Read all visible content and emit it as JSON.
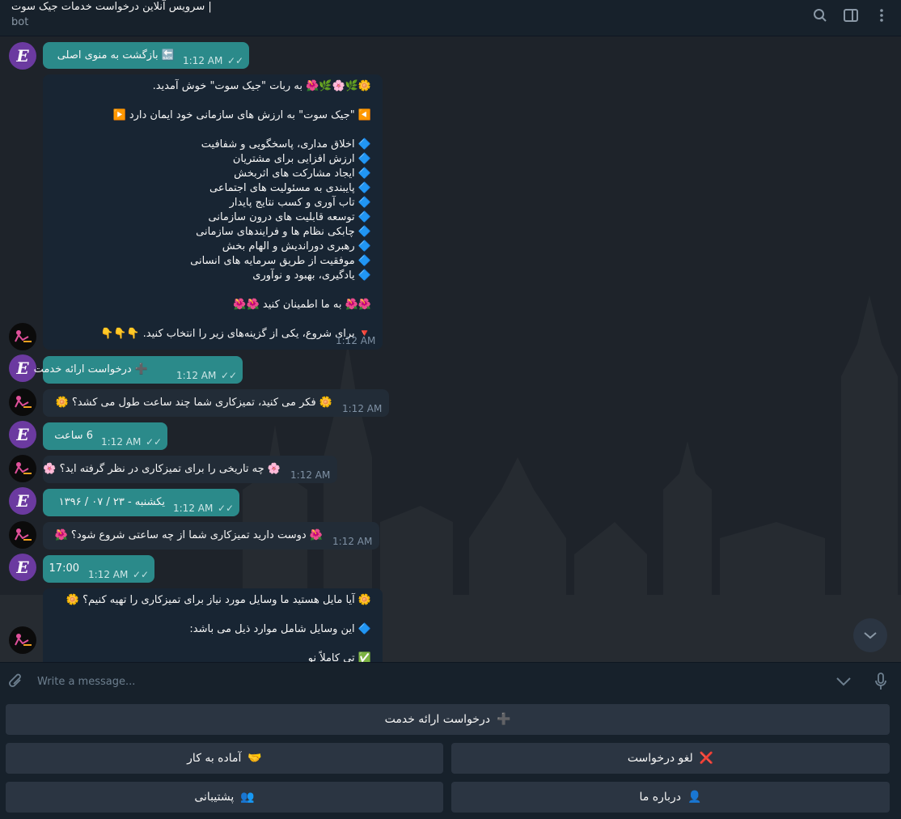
{
  "header": {
    "title": "سرویس آنلاین درخواست خدمات جیک سوت |",
    "subtitle": "bot"
  },
  "user_avatar_letter": "E",
  "messages": [
    {
      "type": "out",
      "emoji": "🔙",
      "text": "بازگشت به منوی اصلی",
      "time": "1:12 AM",
      "ticks": "✓✓"
    },
    {
      "type": "in_big",
      "lines": [
        "🌼🌿🌸🌿🌺 به ربات \"جیک سوت\" خوش آمدید.",
        "",
        "◀️ \"جیک سوت\" به ارزش های  سازمانی خود ایمان دارد ▶️",
        "",
        "🔷 اخلاق مداری، پاسخگویی و شفافیت",
        "🔷 ارزش افزایی برای مشتریان",
        "🔷 ایجاد مشارکت های اثربخش",
        "🔷 پایبندی به مسئولیت های اجتماعی",
        "🔷 تاب آوری و کسب نتایج پایدار",
        "🔷 توسعه قابلیت های درون سازمانی",
        "🔷 چابکی نظام ها و فرایندهای سازمانی",
        "🔷 رهبری دوراندیش و الهام بخش",
        "🔷 موفقیت از طریق سرمایه های انسانی",
        "🔷 یادگیری، بهبود و نوآوری",
        "",
        "🌺🌺 به ما اطمینان کنید 🌺🌺",
        "",
        "🔻 برای شروع، یکی از گزینه‌های زیر را انتخاب کنید. 👇👇👇"
      ],
      "time": "1:12 AM"
    },
    {
      "type": "out",
      "emoji": "➕",
      "text": "درخواست ارائه خدمت",
      "time": "1:12 AM",
      "ticks": "✓✓"
    },
    {
      "type": "in",
      "text": "🌼 فکر می کنید، تمیزکاری شما چند ساعت طول می کشد؟ 🌼",
      "time": "1:12 AM"
    },
    {
      "type": "out",
      "emoji": "",
      "text": "6 ساعت",
      "time": "1:12 AM",
      "ticks": "✓✓"
    },
    {
      "type": "in",
      "text": "🌸 چه تاریخی را برای تمیزکاری در نظر گرفته اید؟ 🌸",
      "time": "1:12 AM"
    },
    {
      "type": "out",
      "emoji": "",
      "text": "یکشنبه  -  ۲۳ / ۰۷ / ۱۳۹۶",
      "time": "1:12 AM",
      "ticks": "✓✓"
    },
    {
      "type": "in",
      "text": "🌺 دوست دارید تمیزکاری شما از چه ساعتی شروع شود؟ 🌺",
      "time": "1:12 AM"
    },
    {
      "type": "out",
      "emoji": "",
      "text": "17:00",
      "time": "1:12 AM",
      "ticks": "✓✓"
    },
    {
      "type": "in_partial",
      "lines": [
        "🌼 آیا مایل هستید ما وسایل مورد نیاز برای تمیزکاری را تهیه کنیم؟ 🌼",
        "",
        "🔷 این وسایل شامل موارد ذیل می باشد:",
        "",
        "✅ تی کاملاً نو"
      ]
    }
  ],
  "composer": {
    "placeholder": "Write a message..."
  },
  "keyboard": {
    "request_service": {
      "emoji": "➕",
      "label": "درخواست ارائه خدمت"
    },
    "cancel_request": {
      "emoji": "❌",
      "label": "لغو درخواست"
    },
    "ready_to_work": {
      "emoji": "🤝",
      "label": "آماده به کار"
    },
    "about_us": {
      "emoji": "👤",
      "label": "درباره ما"
    },
    "support": {
      "emoji": "👥",
      "label": "پشتیبانی"
    }
  },
  "colors": {
    "outgoing": "#2b8a8a",
    "incoming": "#182533",
    "background": "#1e232a",
    "panel": "#17212b",
    "button": "#2b3542"
  }
}
